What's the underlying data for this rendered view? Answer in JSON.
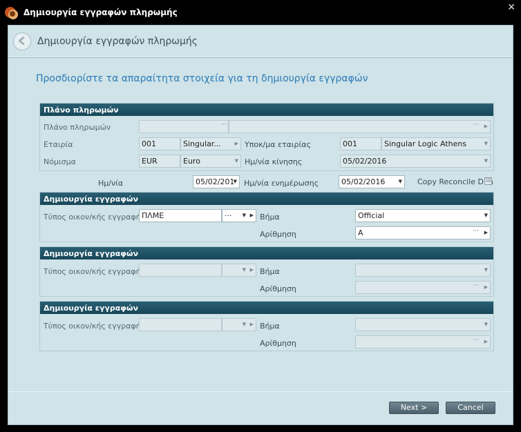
{
  "window": {
    "title": "Δημιουργία εγγραφών πληρωμής",
    "close_label": "✕"
  },
  "header": {
    "title": "Δημιουργία εγγραφών πληρωμής"
  },
  "instruction": "Προσδιορίστε τα απαραίτητα στοιχεία για τη δημιουργία εγγραφών",
  "section1": {
    "title": "Πλάνο πληρωμών",
    "plan_label": "Πλάνο πληρωμών",
    "plan_code": "",
    "plan_desc": "",
    "company_label": "Εταιρία",
    "company_code": "001",
    "company_name": "Singular...",
    "branch_label": "Υποκ/μα εταιρίας",
    "branch_code": "001",
    "branch_name": "Singular Logic Athens",
    "currency_label": "Νόμισμα",
    "currency_code": "EUR",
    "currency_name": "Euro",
    "movement_date_label": "Ημ/νία κίνησης",
    "movement_date": "05/02/2016"
  },
  "dates_row": {
    "date_label": "Ημ/νία",
    "date_value": "05/02/201",
    "update_date_label": "Ημ/νία ενημέρωσης",
    "update_date_value": "05/02/2016",
    "copy_label": "Copy Reconcile Dim",
    "copy_checked_mark": "☒"
  },
  "entries": [
    {
      "title": "Δημιουργία εγγραφών",
      "type_label": "Τύπος οικον/κής εγγραφής",
      "type_value": "ΠΛΜΕ",
      "step_label": "Βήμα",
      "step_value": "Official",
      "numbering_label": "Αρίθμηση",
      "numbering_value": "A"
    },
    {
      "title": "Δημιουργία εγγραφών",
      "type_label": "Τύπος οικον/κής εγγραφής",
      "type_value": "",
      "step_label": "Βήμα",
      "step_value": "",
      "numbering_label": "Αρίθμηση",
      "numbering_value": ""
    },
    {
      "title": "Δημιουργία εγγραφών",
      "type_label": "Τύπος οικον/κής εγγραφής",
      "type_value": "",
      "step_label": "Βήμα",
      "step_value": "",
      "numbering_label": "Αρίθμηση",
      "numbering_value": ""
    }
  ],
  "buttons": {
    "next": "Next >",
    "cancel": "Cancel"
  },
  "icons": {
    "back": "back-arrow-icon",
    "ellipsis": "···",
    "dropdown": "▼",
    "arrow": "▶"
  },
  "colors": {
    "accent": "#2b7ab6",
    "section_header": "#1f4f63",
    "background": "#cfe3e8"
  }
}
